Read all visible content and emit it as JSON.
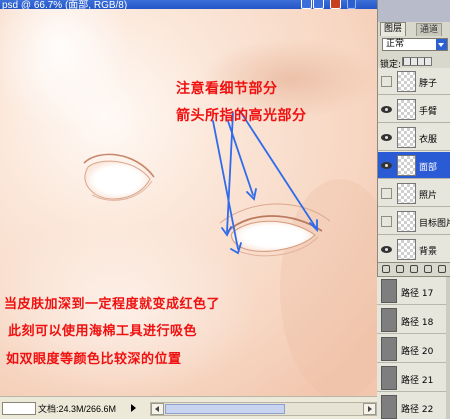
{
  "window": {
    "title": "psd @ 66.7% (面部, RGB/8)"
  },
  "annotations": {
    "line1": "注意看细节部分",
    "line2": "箭头所指的高光部分",
    "line3": "当皮肤加深到一定程度就变成红色了",
    "line4": "此刻可以使用海棉工具进行吸色",
    "line5": "如双眼度等颜色比较深的位置"
  },
  "status": {
    "doc_info": "文档:24.3M/266.6M"
  },
  "panel": {
    "tab_layers": "图层",
    "tab_channels": "通道",
    "blend_mode": "正常",
    "lock_label": "锁定:",
    "layers": [
      {
        "name": "脖子",
        "visible": false,
        "selected": false
      },
      {
        "name": "手臂",
        "visible": true,
        "selected": false
      },
      {
        "name": "衣服",
        "visible": true,
        "selected": false
      },
      {
        "name": "面部",
        "visible": true,
        "selected": true
      },
      {
        "name": "照片",
        "visible": false,
        "selected": false
      },
      {
        "name": "目标图片",
        "visible": false,
        "selected": false
      },
      {
        "name": "背景",
        "visible": true,
        "selected": false
      }
    ]
  },
  "paths": [
    {
      "name": "路径 17"
    },
    {
      "name": "路径 18"
    },
    {
      "name": "路径 20"
    },
    {
      "name": "路径 21"
    },
    {
      "name": "路径 22"
    }
  ],
  "colors": {
    "annotation": "#f01010",
    "arrow": "#2f6bea",
    "skin": "#f8d9c6",
    "selection": "#2a5bd4"
  }
}
